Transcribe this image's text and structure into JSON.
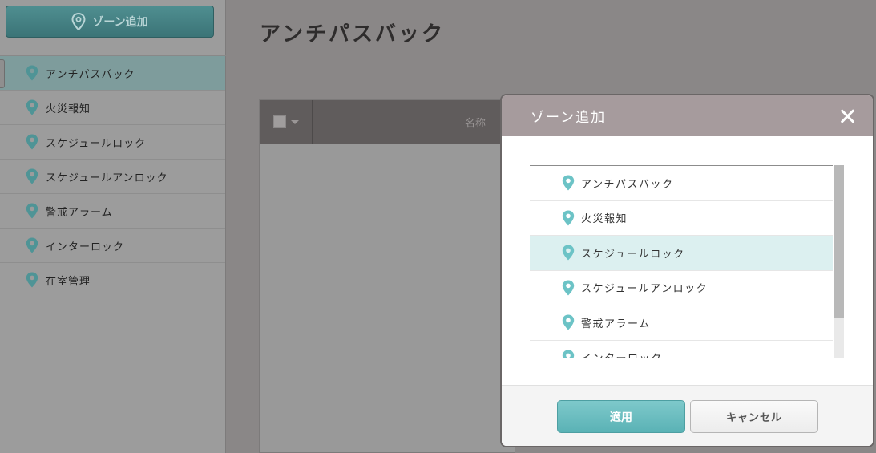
{
  "sidebar": {
    "add_zone_label": "ゾーン追加",
    "items": [
      {
        "label": "アンチパスバック",
        "active": true
      },
      {
        "label": "火災報知",
        "active": false
      },
      {
        "label": "スケジュールロック",
        "active": false
      },
      {
        "label": "スケジュールアンロック",
        "active": false
      },
      {
        "label": "警戒アラーム",
        "active": false
      },
      {
        "label": "インターロック",
        "active": false
      },
      {
        "label": "在室管理",
        "active": false
      }
    ]
  },
  "main": {
    "title": "アンチパスバック",
    "table": {
      "name_column": "名称"
    }
  },
  "modal": {
    "title": "ゾーン追加",
    "items": [
      {
        "label": "アンチパスバック",
        "selected": false
      },
      {
        "label": "火災報知",
        "selected": false
      },
      {
        "label": "スケジュールロック",
        "selected": true
      },
      {
        "label": "スケジュールアンロック",
        "selected": false
      },
      {
        "label": "警戒アラーム",
        "selected": false
      },
      {
        "label": "インターロック",
        "selected": false
      }
    ],
    "apply_label": "適用",
    "cancel_label": "キャンセル"
  },
  "icons": {
    "zone_pin": "location-pin-icon",
    "close": "close-icon",
    "dropdown": "chevron-down-icon"
  },
  "colors": {
    "accent": "#5ab2b5",
    "pin": "#6cc3c6",
    "header_dark": "#605c5c",
    "modal_header": "#a69b9d",
    "selected_row": "#dcf0f0"
  }
}
